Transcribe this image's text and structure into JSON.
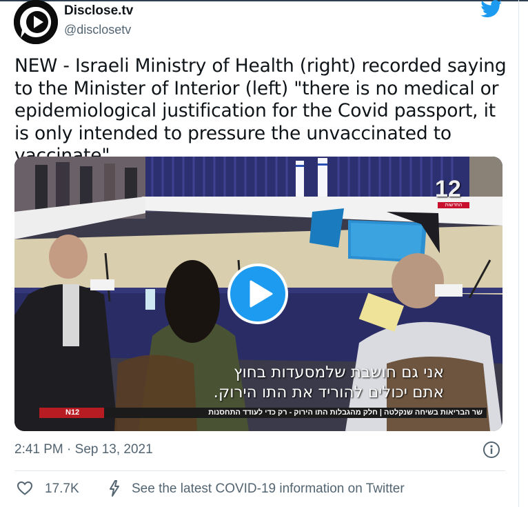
{
  "author": {
    "display_name": "Disclose.tv",
    "handle": "@disclosetv",
    "avatar_icon": "disclose-tv-play-logo"
  },
  "brand_icon": "twitter-bird-icon",
  "colors": {
    "twitter_blue": "#1d9bf0",
    "text_primary": "#0f1419",
    "text_secondary": "#536471",
    "channel_red": "#c8102e"
  },
  "tweet": {
    "text": "NEW - Israeli Ministry of Health (right) recorded saying to the Minister of Interior (left) \"there is no medical or epidemiological justification for the Covid passport, it is only intended to pressure the unvaccinated to vaccinate\"."
  },
  "video": {
    "play_icon": "play-icon",
    "channel_number": "12",
    "channel_bar_text": "החדשות",
    "subtitle_line1": "אני גם חושבת שלמסעדות בחוץ",
    "subtitle_line2": "אתם יכולים להוריד את התו הירוק.",
    "lower_third_text": "שר הבריאות בשיחה שנקלטה | חלק מהגבלות התו הירוק - רק כדי לעודד התחסנות",
    "tag_text": "N12"
  },
  "meta": {
    "timestamp": "2:41 PM · Sep 13, 2021",
    "info_icon": "info-icon"
  },
  "actions": {
    "like_icon": "heart-icon",
    "like_count": "17.7K",
    "bolt_icon": "lightning-bolt-icon",
    "covid_link": "See the latest COVID-19 information on Twitter"
  }
}
